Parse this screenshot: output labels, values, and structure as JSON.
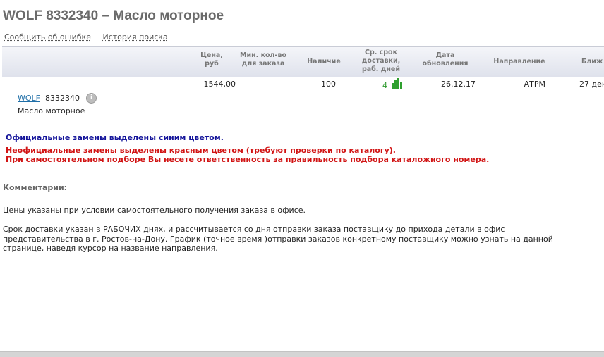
{
  "page": {
    "title": "WOLF 8332340 – Масло моторное"
  },
  "links": {
    "report_error": "Сообщить об ошибке",
    "search_history": "История поиска"
  },
  "table": {
    "headers": {
      "price": [
        "Цена,",
        "руб"
      ],
      "min_qty": [
        "Мин. кол-во",
        "для заказа"
      ],
      "availability": [
        "Наличие"
      ],
      "delivery": [
        "Ср. срок",
        "доставки,",
        "раб. дней"
      ],
      "updated": [
        "Дата",
        "обновления"
      ],
      "direction": [
        "Направление"
      ],
      "nearest": [
        "Ближ"
      ]
    },
    "row": {
      "brand": "WOLF",
      "number": "8332340",
      "description": "Масло моторное",
      "price": "1544,00",
      "min_qty": "",
      "availability": "100",
      "delivery_days": "4",
      "updated": "26.12.17",
      "direction": "АТРМ",
      "nearest": "27 дек"
    }
  },
  "icons": {
    "info": "info-icon",
    "bars": "bar-chart-icon"
  },
  "colors": {
    "official": "#14149a",
    "unofficial": "#d11414",
    "link": "#1f6fa8",
    "green": "#2e9a2e"
  },
  "notes": {
    "official": "Официальные замены выделены синим цветом.",
    "unofficial": "Неофициальные замены выделены красным цветом (требуют проверки по каталогу).",
    "responsibility": "При самостоятельном подборе Вы несете ответственность за правильность подбора каталожного номера."
  },
  "comments": {
    "title": "Комментарии:",
    "p1": "Цены указаны при условии самостоятельного получения заказа в офисе.",
    "p2": "Срок доставки указан в РАБОЧИХ днях, и рассчитывается со дня отправки заказа поставщику до прихода детали в офис представительства в г. Ростов-на-Дону. График (точное время )отправки заказов конкретному поставщику можно узнать на данной странице, наведя курсор на название направления."
  }
}
